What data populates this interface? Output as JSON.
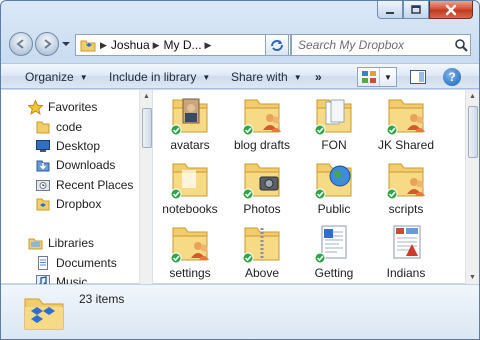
{
  "window": {
    "controls": {
      "minimize_icon": "minimize-icon",
      "maximize_icon": "maximize-icon",
      "close_icon": "close-icon"
    }
  },
  "address_bar": {
    "crumbs": [
      "Joshua",
      "My D..."
    ],
    "search_placeholder": "Search My Dropbox"
  },
  "command_bar": {
    "organize": "Organize",
    "include_in_library": "Include in library",
    "share_with": "Share with",
    "more": "»"
  },
  "nav_pane": {
    "favorites_label": "Favorites",
    "favorites": [
      {
        "label": "code",
        "icon": "folder-icon"
      },
      {
        "label": "Desktop",
        "icon": "desktop-icon"
      },
      {
        "label": "Downloads",
        "icon": "downloads-icon"
      },
      {
        "label": "Recent Places",
        "icon": "recent-places-icon"
      },
      {
        "label": "Dropbox",
        "icon": "dropbox-icon"
      }
    ],
    "libraries_label": "Libraries",
    "libraries": [
      {
        "label": "Documents",
        "icon": "documents-icon"
      },
      {
        "label": "Music",
        "icon": "music-icon"
      }
    ]
  },
  "content": {
    "items": [
      {
        "label": "avatars",
        "kind": "folder-photo"
      },
      {
        "label": "blog drafts",
        "kind": "folder-shared"
      },
      {
        "label": "FON",
        "kind": "folder-docs"
      },
      {
        "label": "JK Shared",
        "kind": "folder-shared"
      },
      {
        "label": "notebooks",
        "kind": "folder-plain"
      },
      {
        "label": "Photos",
        "kind": "folder-camera"
      },
      {
        "label": "Public",
        "kind": "folder-globe"
      },
      {
        "label": "scripts",
        "kind": "folder-shared"
      },
      {
        "label": "settings",
        "kind": "folder-shared"
      },
      {
        "label": "Above",
        "kind": "folder-zip"
      },
      {
        "label": "Getting",
        "kind": "file-doc"
      },
      {
        "label": "Indians",
        "kind": "file-pdf"
      }
    ]
  },
  "details_pane": {
    "item_count": "23 items"
  },
  "colors": {
    "folder": "#f2cd6b",
    "sync_green": "#2fa64a",
    "accent_blue": "#1c5fb4"
  }
}
